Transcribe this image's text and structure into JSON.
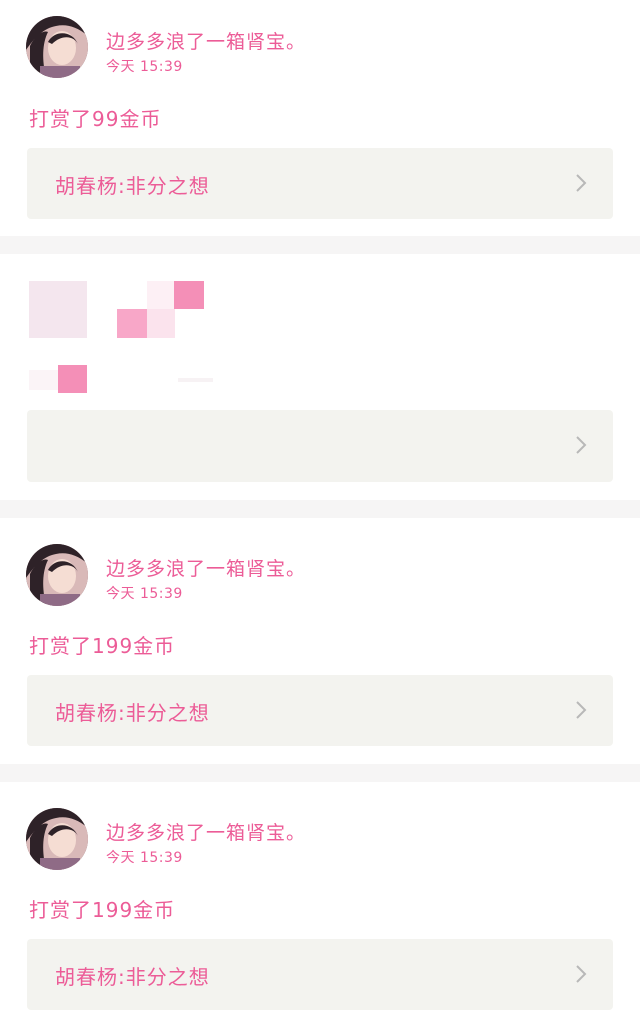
{
  "posts": [
    {
      "username": "边多多浪了一箱肾宝。",
      "time": "今天 15:39",
      "reward": "打赏了99金币",
      "link_text": "胡春杨:非分之想"
    },
    {
      "username": "",
      "time": "",
      "reward": "",
      "link_text": ""
    },
    {
      "username": "边多多浪了一箱肾宝。",
      "time": "今天 15:39",
      "reward": "打赏了199金币",
      "link_text": "胡春杨:非分之想"
    },
    {
      "username": "边多多浪了一箱肾宝。",
      "time": "今天 15:39",
      "reward": "打赏了199金币",
      "link_text": "胡春杨:非分之想"
    }
  ],
  "colors": {
    "accent": "#ec5c97",
    "card_bg": "#ffffff",
    "link_box_bg": "#f3f3ef",
    "separator": "#f6f5f5",
    "pixelated_pink": "#f48fb7",
    "pixelated_light": "#f4e6ee"
  },
  "icons": {
    "avatar": "user-avatar-photo",
    "chevron": "chevron-right-icon"
  }
}
